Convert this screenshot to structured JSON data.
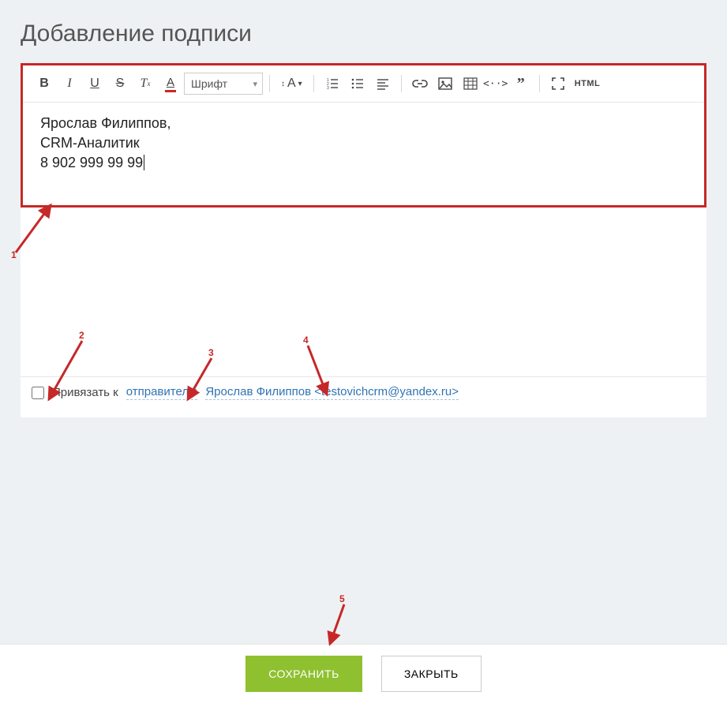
{
  "header": {
    "title": "Добавление подписи"
  },
  "toolbar": {
    "font_select_label": "Шрифт",
    "size_label": "A",
    "html_label": "HTML"
  },
  "editor": {
    "line1": "Ярослав Филиппов,",
    "line2": "CRM-Аналитик",
    "line3": "8 902 999 99 99"
  },
  "bind": {
    "label": "Привязать к",
    "target_type": "отправителю",
    "target_value": "Ярослав Филиппов <testovichcrm@yandex.ru>"
  },
  "footer": {
    "save": "СОХРАНИТЬ",
    "close": "ЗАКРЫТЬ"
  },
  "annotations": {
    "a1": "1",
    "a2": "2",
    "a3": "3",
    "a4": "4",
    "a5": "5"
  }
}
